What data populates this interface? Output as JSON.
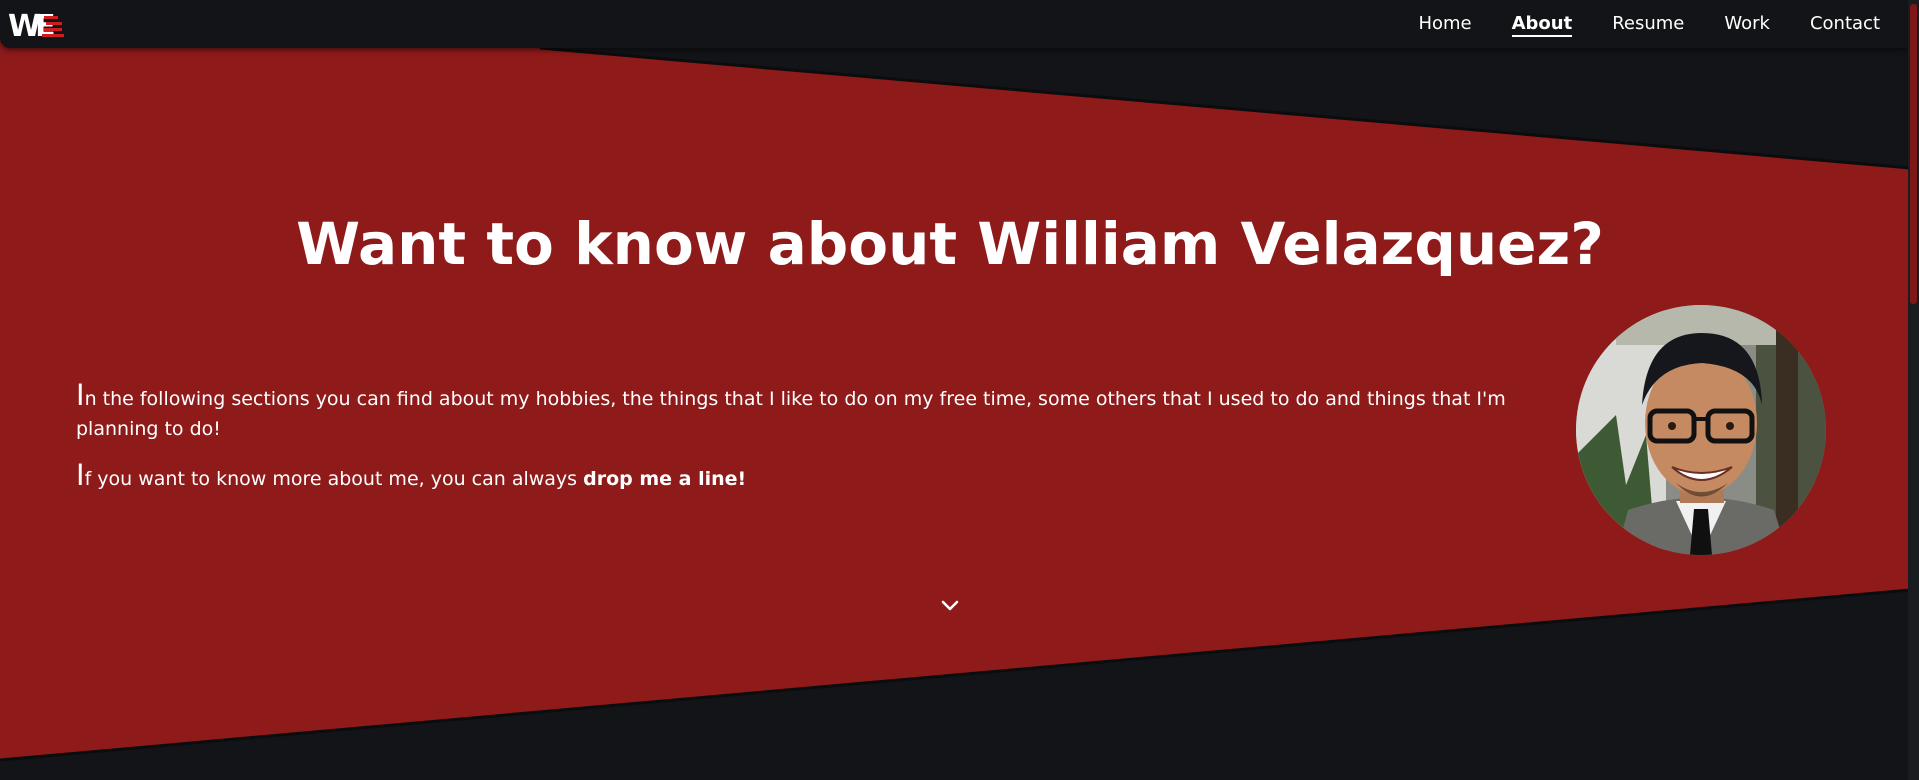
{
  "logo": {
    "text": "WE"
  },
  "nav": {
    "items": [
      "Home",
      "About",
      "Resume",
      "Work",
      "Contact"
    ],
    "active": "About"
  },
  "hero": {
    "title": "Want to know about William Velazquez?",
    "paragraph1_cap": "I",
    "paragraph1_rest": "n the following sections you can find about my hobbies, the things that I like to do on my free time, some others that I used to do and things that I'm planning to do!",
    "paragraph2_cap": "I",
    "paragraph2_rest": "f you want to know more about me, you can always ",
    "paragraph2_link": "drop me a line!"
  },
  "colors": {
    "background": "#121418",
    "accent": "#8f1a1a",
    "text": "#ffffff"
  },
  "icons": {
    "scroll_down": "chevron-down-icon"
  }
}
